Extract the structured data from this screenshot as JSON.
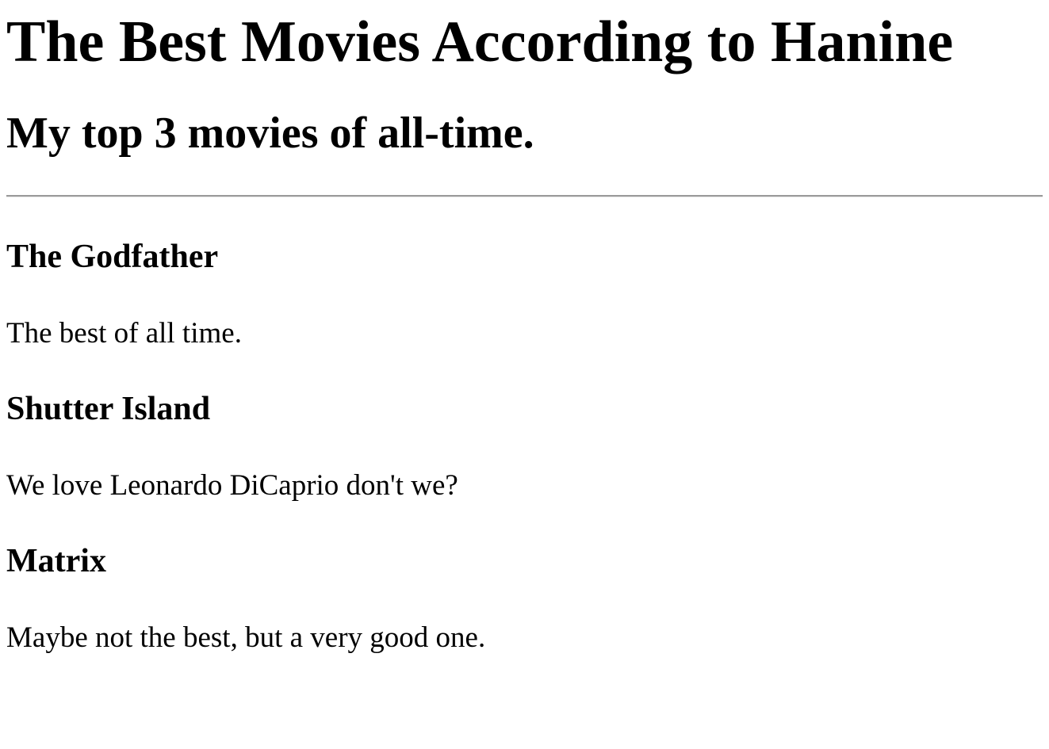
{
  "page": {
    "title": "The Best Movies According to Hanine",
    "subtitle": "My top 3 movies of all-time."
  },
  "movies": [
    {
      "title": "The Godfather",
      "description": "The best of all time."
    },
    {
      "title": "Shutter Island",
      "description": "We love Leonardo DiCaprio don't we?"
    },
    {
      "title": "Matrix",
      "description": "Maybe not the best, but a very good one."
    }
  ]
}
